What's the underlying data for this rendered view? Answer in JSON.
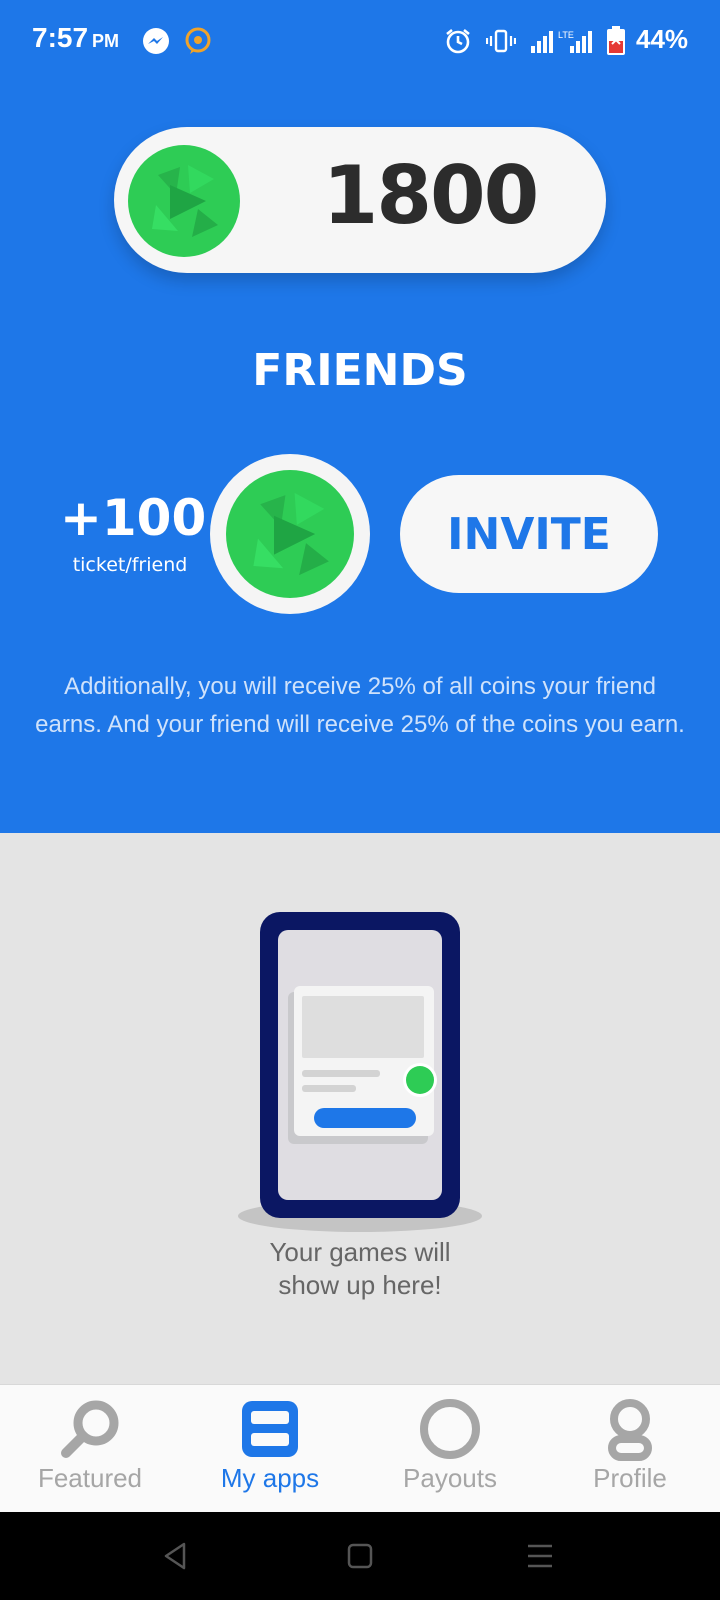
{
  "status_bar": {
    "time": "7:57",
    "ampm": "PM",
    "battery": "44%",
    "icons": [
      "messenger-icon",
      "chat-bubble-icon",
      "alarm-icon",
      "vibrate-icon",
      "signal-icon",
      "lte-signal-icon",
      "battery-icon"
    ]
  },
  "balance": {
    "coins": "1800",
    "icon": "coin-icon"
  },
  "friends": {
    "title": "FRIENDS",
    "reward_amount": "+100",
    "reward_unit": "ticket/friend",
    "invite_label": "INVITE",
    "description": "Additionally, you will receive 25% of all coins your friend earns. And your friend will receive 25% of the coins you earn."
  },
  "empty_state": {
    "line1": "Your games will",
    "line2": "show up here!"
  },
  "nav": {
    "items": [
      {
        "label": "Featured",
        "icon": "search-icon",
        "active": false
      },
      {
        "label": "My apps",
        "icon": "apps-icon",
        "active": true
      },
      {
        "label": "Payouts",
        "icon": "ring-icon",
        "active": false
      },
      {
        "label": "Profile",
        "icon": "person-icon",
        "active": false
      }
    ]
  },
  "colors": {
    "primary": "#1e77e8",
    "coin_green": "#2ecc55",
    "background_gray": "#e4e4e4",
    "nav_inactive": "#a6a6a6"
  }
}
